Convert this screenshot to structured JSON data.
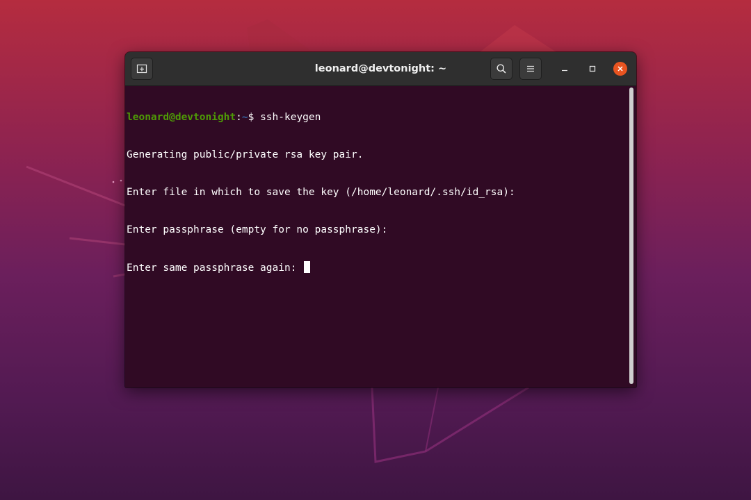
{
  "window": {
    "title": "leonard@devtonight: ~"
  },
  "terminal": {
    "prompt_user_host": "leonard@devtonight",
    "prompt_separator": ":",
    "prompt_path": "~",
    "prompt_symbol": "$ ",
    "command": "ssh-keygen",
    "output": [
      "Generating public/private rsa key pair.",
      "Enter file in which to save the key (/home/leonard/.ssh/id_rsa):",
      "Enter passphrase (empty for no passphrase):",
      "Enter same passphrase again: "
    ]
  },
  "icons": {
    "new_tab": "new-tab-icon",
    "search": "search-icon",
    "menu": "hamburger-menu-icon",
    "minimize": "minimize-icon",
    "maximize": "maximize-icon",
    "close": "close-icon"
  },
  "colors": {
    "terminal_background": "#300a24",
    "titlebar_background": "#2f2f2f",
    "prompt_user": "#4e9a06",
    "prompt_path": "#3465a4",
    "close_button": "#e95420"
  }
}
